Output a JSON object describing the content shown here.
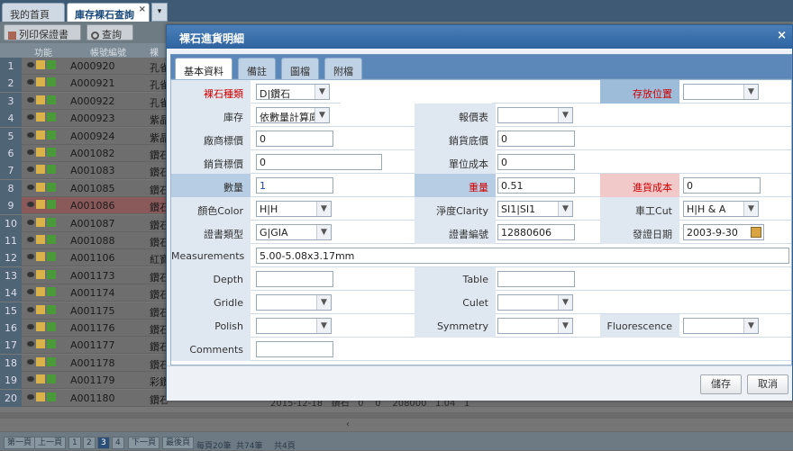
{
  "app": {
    "tabs": [
      {
        "label": "我的首頁"
      },
      {
        "label": "庫存裸石查詢",
        "close": "×"
      }
    ],
    "tab_menu": "▾",
    "toolbar": {
      "print_label": "列印保證書",
      "query_label": "查詢"
    },
    "grid": {
      "headers": [
        "功能",
        "帳號編號",
        "裸"
      ],
      "rows": [
        {
          "n": "1",
          "code": "A000920",
          "t": "孔雀"
        },
        {
          "n": "2",
          "code": "A000921",
          "t": "孔雀"
        },
        {
          "n": "3",
          "code": "A000922",
          "t": "孔雀"
        },
        {
          "n": "4",
          "code": "A000923",
          "t": "紫晶"
        },
        {
          "n": "5",
          "code": "A000924",
          "t": "紫晶"
        },
        {
          "n": "6",
          "code": "A001082",
          "t": "鑽石"
        },
        {
          "n": "7",
          "code": "A001083",
          "t": "鑽石"
        },
        {
          "n": "8",
          "code": "A001085",
          "t": "鑽石"
        },
        {
          "n": "9",
          "code": "A001086",
          "t": "鑽石"
        },
        {
          "n": "10",
          "code": "A001087",
          "t": "鑽石"
        },
        {
          "n": "11",
          "code": "A001088",
          "t": "鑽石"
        },
        {
          "n": "12",
          "code": "A001106",
          "t": "紅寶"
        },
        {
          "n": "13",
          "code": "A001173",
          "t": "鑽石"
        },
        {
          "n": "14",
          "code": "A001174",
          "t": "鑽石"
        },
        {
          "n": "15",
          "code": "A001175",
          "t": "鑽石"
        },
        {
          "n": "16",
          "code": "A001176",
          "t": "鑽石"
        },
        {
          "n": "17",
          "code": "A001177",
          "t": "鑽石"
        },
        {
          "n": "18",
          "code": "A001178",
          "t": "鑽石"
        },
        {
          "n": "19",
          "code": "A001179",
          "t": "彩鑽"
        },
        {
          "n": "20",
          "code": "A001180",
          "t": "鑽石"
        }
      ],
      "selected_row_index": 8,
      "scroll_left": "‹",
      "row20_extra": "2015-12-18   鑽石   0    0    208000   1.04   1"
    },
    "pager": {
      "first": "第一頁",
      "prev": "上一頁",
      "pages": [
        "1",
        "2",
        "3",
        "4"
      ],
      "current": "3",
      "next": "下一頁",
      "last": "最後頁",
      "per_page": "每頁20筆",
      "total_rows": "共74筆",
      "total_pages": "共4頁"
    }
  },
  "dialog": {
    "title": "裸石進貨明細",
    "close": "×",
    "tabs": [
      "基本資料",
      "備註",
      "圖檔",
      "附檔"
    ],
    "active_tab": 0,
    "fields": {
      "stone_type": {
        "label": "裸石種類",
        "value": "D|鑽石"
      },
      "location": {
        "label": "存放位置",
        "value": ""
      },
      "stock": {
        "label": "庫存",
        "value": "依數量計算庫存"
      },
      "quote": {
        "label": "報價表",
        "value": ""
      },
      "vendor_price": {
        "label": "廠商標價",
        "value": "0"
      },
      "sale_floor": {
        "label": "銷貨底價",
        "value": "0"
      },
      "sale_price": {
        "label": "銷貨標價",
        "value": "0"
      },
      "unit_cost": {
        "label": "單位成本",
        "value": "0"
      },
      "qty": {
        "label": "數量",
        "value": "1"
      },
      "weight": {
        "label": "重量",
        "value": "0.51"
      },
      "cost": {
        "label": "進貨成本",
        "value": "0"
      },
      "color": {
        "label": "顏色Color",
        "value": "H|H"
      },
      "clarity": {
        "label": "淨度Clarity",
        "value": "SI1|SI1"
      },
      "cut": {
        "label": "車工Cut",
        "value": "H|H & A"
      },
      "cert_type": {
        "label": "證書類型",
        "value": "G|GIA"
      },
      "cert_no": {
        "label": "證書編號",
        "value": "12880606"
      },
      "issue_date": {
        "label": "發證日期",
        "value": "2003-9-30"
      },
      "measurements": {
        "label": "Measurements",
        "value": "5.00-5.08x3.17mm"
      },
      "depth": {
        "label": "Depth",
        "value": ""
      },
      "table": {
        "label": "Table",
        "value": ""
      },
      "girdle": {
        "label": "Gridle",
        "value": ""
      },
      "culet": {
        "label": "Culet",
        "value": ""
      },
      "polish": {
        "label": "Polish",
        "value": ""
      },
      "symmetry": {
        "label": "Symmetry",
        "value": ""
      },
      "fluorescence": {
        "label": "Fluorescence",
        "value": ""
      },
      "comments": {
        "label": "Comments",
        "value": ""
      }
    },
    "buttons": {
      "save": "儲存",
      "cancel": "取消"
    }
  },
  "colors": {
    "accent": "#2e64a0",
    "required": "#d10000",
    "selected_row": "#8a5a5a"
  }
}
